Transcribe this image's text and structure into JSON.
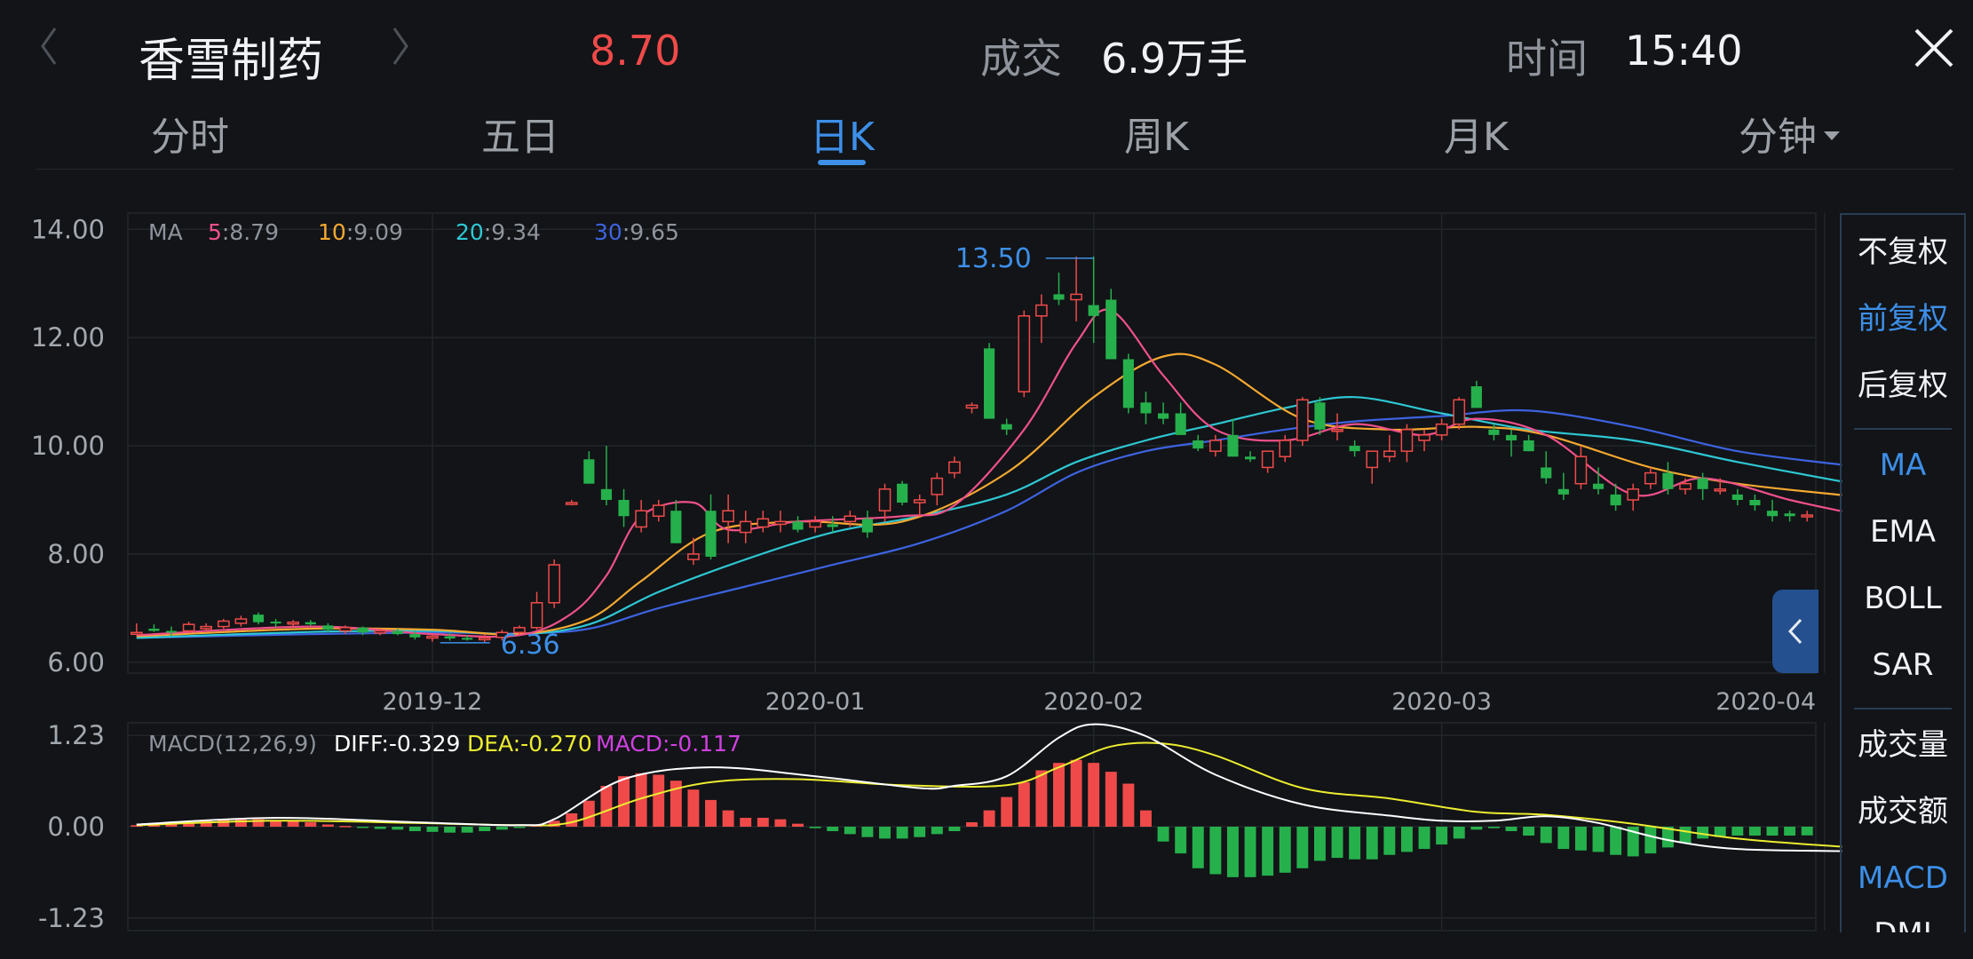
{
  "header": {
    "stock_name": "香雪制药",
    "price": "8.70",
    "volume_label": "成交",
    "volume_value": "6.9万手",
    "time_label": "时间",
    "time_value": "15:40"
  },
  "tabs": [
    {
      "label": "分时",
      "active": false
    },
    {
      "label": "五日",
      "active": false
    },
    {
      "label": "日K",
      "active": true
    },
    {
      "label": "周K",
      "active": false
    },
    {
      "label": "月K",
      "active": false
    },
    {
      "label": "分钟",
      "active": false
    }
  ],
  "side_panel": {
    "items": [
      "不复权",
      "前复权",
      "后复权",
      "MA",
      "EMA",
      "BOLL",
      "SAR",
      "成交量",
      "成交额",
      "MACD",
      "DMI"
    ],
    "highlighted": [
      "前复权",
      "MA",
      "MACD"
    ]
  },
  "colors": {
    "up": "#ef4a49",
    "down": "#26b04c",
    "ma5": "#f0508c",
    "ma10": "#f4a831",
    "ma20": "#2ec7d3",
    "ma30": "#3d63e0",
    "diff": "#ffffff",
    "dea": "#ecec30",
    "macd": "#d040e0",
    "accent": "#3d8fe8",
    "background": "#121417"
  },
  "legend": {
    "ma_prefix": "MA",
    "ma5_key": "5",
    "ma5_val": ":8.79",
    "ma10_key": "10",
    "ma10_val": ":9.09",
    "ma20_key": "20",
    "ma20_val": ":9.34",
    "ma30_key": "30",
    "ma30_val": ":9.65",
    "macd_title": "MACD(12,26,9)",
    "diff_text": "DIFF:-0.329",
    "dea_text": "DEA:-0.270",
    "macd_text": "MACD:-0.117"
  },
  "chart_data": [
    {
      "type": "candlestick",
      "y_ticks": [
        "14.00",
        "12.00",
        "10.00",
        "8.00",
        "6.00"
      ],
      "y_tick_values": [
        14,
        12,
        10,
        8,
        6
      ],
      "ylim": [
        5.8,
        14.3
      ],
      "x_ticks": [
        "2019-12",
        "2020-01",
        "2020-02",
        "2020-03",
        "2020-04"
      ],
      "x_tick_index": [
        17.5,
        39.5,
        55.5,
        75.5,
        97.5
      ],
      "max_label": "13.50",
      "min_label": "6.36",
      "max_index": 55,
      "min_index": 20,
      "candles": [
        [
          6.55,
          6.72,
          6.5,
          6.55
        ],
        [
          6.62,
          6.7,
          6.56,
          6.58
        ],
        [
          6.58,
          6.66,
          6.48,
          6.55
        ],
        [
          6.58,
          6.75,
          6.55,
          6.7
        ],
        [
          6.62,
          6.72,
          6.57,
          6.66
        ],
        [
          6.66,
          6.8,
          6.62,
          6.76
        ],
        [
          6.72,
          6.86,
          6.66,
          6.8
        ],
        [
          6.88,
          6.92,
          6.7,
          6.74
        ],
        [
          6.75,
          6.8,
          6.65,
          6.72
        ],
        [
          6.72,
          6.78,
          6.66,
          6.74
        ],
        [
          6.74,
          6.78,
          6.68,
          6.7
        ],
        [
          6.68,
          6.72,
          6.55,
          6.6
        ],
        [
          6.58,
          6.68,
          6.52,
          6.64
        ],
        [
          6.64,
          6.66,
          6.5,
          6.55
        ],
        [
          6.54,
          6.62,
          6.5,
          6.58
        ],
        [
          6.58,
          6.62,
          6.5,
          6.52
        ],
        [
          6.52,
          6.58,
          6.42,
          6.46
        ],
        [
          6.46,
          6.52,
          6.38,
          6.48
        ],
        [
          6.48,
          6.54,
          6.4,
          6.44
        ],
        [
          6.45,
          6.5,
          6.4,
          6.44
        ],
        [
          6.44,
          6.52,
          6.36,
          6.45
        ],
        [
          6.46,
          6.6,
          6.4,
          6.55
        ],
        [
          6.55,
          6.68,
          6.5,
          6.64
        ],
        [
          6.64,
          7.3,
          6.6,
          7.1
        ],
        [
          7.1,
          7.9,
          7.0,
          7.8
        ],
        [
          8.95,
          9.0,
          8.9,
          8.95
        ],
        [
          9.75,
          9.9,
          9.3,
          9.3
        ],
        [
          9.2,
          10.0,
          8.9,
          9.0
        ],
        [
          9.0,
          9.2,
          8.5,
          8.7
        ],
        [
          8.5,
          9.0,
          8.4,
          8.8
        ],
        [
          8.7,
          9.0,
          8.6,
          8.9
        ],
        [
          8.8,
          9.0,
          8.2,
          8.2
        ],
        [
          7.9,
          8.3,
          7.8,
          8.0
        ],
        [
          8.8,
          9.1,
          7.9,
          7.95
        ],
        [
          8.6,
          9.1,
          8.2,
          8.8
        ],
        [
          8.4,
          8.8,
          8.2,
          8.6
        ],
        [
          8.5,
          8.8,
          8.4,
          8.65
        ],
        [
          8.55,
          8.8,
          8.4,
          8.6
        ],
        [
          8.6,
          8.7,
          8.4,
          8.45
        ],
        [
          8.5,
          8.7,
          8.4,
          8.6
        ],
        [
          8.55,
          8.7,
          8.4,
          8.5
        ],
        [
          8.6,
          8.8,
          8.5,
          8.7
        ],
        [
          8.65,
          8.8,
          8.3,
          8.4
        ],
        [
          8.8,
          9.3,
          8.6,
          9.2
        ],
        [
          9.3,
          9.35,
          8.9,
          8.95
        ],
        [
          8.95,
          9.1,
          8.7,
          9.0
        ],
        [
          9.1,
          9.5,
          8.9,
          9.4
        ],
        [
          9.5,
          9.8,
          9.4,
          9.7
        ],
        [
          10.7,
          10.8,
          10.6,
          10.75
        ],
        [
          11.8,
          11.9,
          10.5,
          10.5
        ],
        [
          10.4,
          10.5,
          10.2,
          10.3
        ],
        [
          11.0,
          12.5,
          10.9,
          12.4
        ],
        [
          12.4,
          12.8,
          11.9,
          12.6
        ],
        [
          12.8,
          13.2,
          12.6,
          12.7
        ],
        [
          12.7,
          13.5,
          12.3,
          12.8
        ],
        [
          12.6,
          13.5,
          11.9,
          12.4
        ],
        [
          12.7,
          12.9,
          11.6,
          11.6
        ],
        [
          11.6,
          11.7,
          10.6,
          10.7
        ],
        [
          10.8,
          11.0,
          10.4,
          10.6
        ],
        [
          10.6,
          10.8,
          10.4,
          10.5
        ],
        [
          10.6,
          10.8,
          10.2,
          10.2
        ],
        [
          10.1,
          10.2,
          9.9,
          9.95
        ],
        [
          9.9,
          10.2,
          9.8,
          10.1
        ],
        [
          10.2,
          10.5,
          9.8,
          9.8
        ],
        [
          9.8,
          9.9,
          9.7,
          9.75
        ],
        [
          9.6,
          9.9,
          9.5,
          9.9
        ],
        [
          9.8,
          10.2,
          9.7,
          10.1
        ],
        [
          10.1,
          10.9,
          10.0,
          10.85
        ],
        [
          10.8,
          10.9,
          10.2,
          10.3
        ],
        [
          10.3,
          10.6,
          10.1,
          10.3
        ],
        [
          10.0,
          10.1,
          9.8,
          9.9
        ],
        [
          9.6,
          9.9,
          9.3,
          9.9
        ],
        [
          9.8,
          10.2,
          9.7,
          9.9
        ],
        [
          9.9,
          10.4,
          9.7,
          10.3
        ],
        [
          10.1,
          10.3,
          9.9,
          10.2
        ],
        [
          10.2,
          10.5,
          10.1,
          10.4
        ],
        [
          10.4,
          10.9,
          10.3,
          10.85
        ],
        [
          11.1,
          11.2,
          10.7,
          10.7
        ],
        [
          10.3,
          10.4,
          10.1,
          10.2
        ],
        [
          10.2,
          10.3,
          9.8,
          10.1
        ],
        [
          10.1,
          10.2,
          9.9,
          9.9
        ],
        [
          9.6,
          9.9,
          9.3,
          9.4
        ],
        [
          9.2,
          9.5,
          9.0,
          9.1
        ],
        [
          9.3,
          10.0,
          9.2,
          9.8
        ],
        [
          9.3,
          9.6,
          9.1,
          9.2
        ],
        [
          9.1,
          9.3,
          8.8,
          8.9
        ],
        [
          9.0,
          9.3,
          8.8,
          9.2
        ],
        [
          9.3,
          9.6,
          9.2,
          9.5
        ],
        [
          9.5,
          9.7,
          9.1,
          9.2
        ],
        [
          9.2,
          9.4,
          9.1,
          9.3
        ],
        [
          9.4,
          9.5,
          9.0,
          9.2
        ],
        [
          9.2,
          9.4,
          9.1,
          9.2
        ],
        [
          9.1,
          9.2,
          8.9,
          9.0
        ],
        [
          9.0,
          9.1,
          8.8,
          8.9
        ],
        [
          8.8,
          9.0,
          8.6,
          8.7
        ],
        [
          8.75,
          8.8,
          8.6,
          8.7
        ],
        [
          8.7,
          8.8,
          8.6,
          8.72
        ]
      ],
      "ma_series": {
        "MA5": [
          [
            0,
            6.5
          ],
          [
            10,
            6.66
          ],
          [
            17,
            6.52
          ],
          [
            22,
            6.5
          ],
          [
            25,
            6.9
          ],
          [
            27,
            7.6
          ],
          [
            29,
            8.7
          ],
          [
            32,
            8.95
          ],
          [
            34,
            8.45
          ],
          [
            38,
            8.6
          ],
          [
            44,
            8.7
          ],
          [
            47,
            8.9
          ],
          [
            51,
            10.3
          ],
          [
            54,
            11.9
          ],
          [
            56,
            12.5
          ],
          [
            59,
            11.3
          ],
          [
            62,
            10.3
          ],
          [
            66,
            10.1
          ],
          [
            70,
            10.4
          ],
          [
            74,
            10.2
          ],
          [
            77,
            10.5
          ],
          [
            81,
            10.2
          ],
          [
            86,
            9.1
          ],
          [
            90,
            9.4
          ],
          [
            95,
            9.0
          ],
          [
            98,
            8.79
          ]
        ],
        "MA10": [
          [
            0,
            6.48
          ],
          [
            10,
            6.62
          ],
          [
            17,
            6.6
          ],
          [
            22,
            6.52
          ],
          [
            26,
            6.8
          ],
          [
            29,
            7.5
          ],
          [
            33,
            8.4
          ],
          [
            38,
            8.6
          ],
          [
            44,
            8.6
          ],
          [
            50,
            9.5
          ],
          [
            55,
            10.9
          ],
          [
            59,
            11.65
          ],
          [
            62,
            11.5
          ],
          [
            67,
            10.5
          ],
          [
            72,
            10.3
          ],
          [
            77,
            10.35
          ],
          [
            81,
            10.2
          ],
          [
            87,
            9.6
          ],
          [
            92,
            9.3
          ],
          [
            98,
            9.09
          ]
        ],
        "MA20": [
          [
            0,
            6.45
          ],
          [
            10,
            6.56
          ],
          [
            17,
            6.58
          ],
          [
            22,
            6.52
          ],
          [
            26,
            6.7
          ],
          [
            30,
            7.3
          ],
          [
            35,
            7.9
          ],
          [
            40,
            8.4
          ],
          [
            45,
            8.7
          ],
          [
            50,
            9.1
          ],
          [
            54,
            9.7
          ],
          [
            58,
            10.1
          ],
          [
            62,
            10.4
          ],
          [
            66,
            10.7
          ],
          [
            70,
            10.9
          ],
          [
            75,
            10.6
          ],
          [
            80,
            10.3
          ],
          [
            86,
            10.1
          ],
          [
            92,
            9.7
          ],
          [
            98,
            9.34
          ]
        ],
        "MA30": [
          [
            0,
            6.45
          ],
          [
            10,
            6.52
          ],
          [
            17,
            6.55
          ],
          [
            22,
            6.53
          ],
          [
            26,
            6.62
          ],
          [
            30,
            7.0
          ],
          [
            35,
            7.4
          ],
          [
            40,
            7.8
          ],
          [
            45,
            8.2
          ],
          [
            50,
            8.8
          ],
          [
            54,
            9.5
          ],
          [
            58,
            9.9
          ],
          [
            62,
            10.1
          ],
          [
            66,
            10.3
          ],
          [
            70,
            10.45
          ],
          [
            75,
            10.55
          ],
          [
            80,
            10.65
          ],
          [
            86,
            10.35
          ],
          [
            92,
            9.9
          ],
          [
            98,
            9.65
          ]
        ]
      }
    },
    {
      "type": "macd",
      "y_ticks": [
        "1.23",
        "0.00",
        "-1.23"
      ],
      "y_tick_values": [
        1.23,
        0.0,
        -1.23
      ],
      "ylim": [
        -1.4,
        1.4
      ],
      "histogram": [
        0.02,
        0.03,
        0.04,
        0.06,
        0.08,
        0.09,
        0.1,
        0.1,
        0.09,
        0.08,
        0.06,
        0.03,
        0.01,
        -0.01,
        -0.03,
        -0.04,
        -0.06,
        -0.07,
        -0.08,
        -0.08,
        -0.06,
        -0.04,
        -0.01,
        0.03,
        0.08,
        0.18,
        0.35,
        0.55,
        0.68,
        0.72,
        0.7,
        0.62,
        0.5,
        0.36,
        0.22,
        0.12,
        0.12,
        0.1,
        0.04,
        -0.02,
        -0.06,
        -0.1,
        -0.14,
        -0.16,
        -0.16,
        -0.14,
        -0.1,
        -0.06,
        0.06,
        0.22,
        0.4,
        0.6,
        0.76,
        0.86,
        0.9,
        0.86,
        0.74,
        0.58,
        0.22,
        -0.2,
        -0.36,
        -0.56,
        -0.64,
        -0.68,
        -0.68,
        -0.66,
        -0.62,
        -0.56,
        -0.46,
        -0.42,
        -0.44,
        -0.44,
        -0.38,
        -0.34,
        -0.3,
        -0.24,
        -0.16,
        -0.04,
        -0.02,
        -0.06,
        -0.12,
        -0.22,
        -0.3,
        -0.32,
        -0.34,
        -0.38,
        -0.4,
        -0.36,
        -0.28,
        -0.22,
        -0.16,
        -0.14,
        -0.12,
        -0.12,
        -0.12,
        -0.12,
        -0.117
      ],
      "diff_line": [
        [
          0,
          0.03
        ],
        [
          8,
          0.12
        ],
        [
          16,
          0.06
        ],
        [
          22,
          0.02
        ],
        [
          24,
          0.1
        ],
        [
          28,
          0.64
        ],
        [
          33,
          0.8
        ],
        [
          39,
          0.68
        ],
        [
          45,
          0.52
        ],
        [
          47,
          0.55
        ],
        [
          50,
          0.68
        ],
        [
          53,
          1.2
        ],
        [
          55,
          1.38
        ],
        [
          58,
          1.22
        ],
        [
          62,
          0.7
        ],
        [
          67,
          0.3
        ],
        [
          72,
          0.15
        ],
        [
          75,
          0.08
        ],
        [
          78,
          0.08
        ],
        [
          81,
          0.14
        ],
        [
          84,
          0.05
        ],
        [
          88,
          -0.18
        ],
        [
          92,
          -0.3
        ],
        [
          98,
          -0.329
        ]
      ],
      "dea_line": [
        [
          0,
          0.02
        ],
        [
          8,
          0.08
        ],
        [
          16,
          0.05
        ],
        [
          22,
          0.02
        ],
        [
          25,
          0.06
        ],
        [
          29,
          0.38
        ],
        [
          33,
          0.6
        ],
        [
          38,
          0.64
        ],
        [
          44,
          0.56
        ],
        [
          50,
          0.56
        ],
        [
          53,
          0.8
        ],
        [
          56,
          1.08
        ],
        [
          59,
          1.12
        ],
        [
          62,
          0.96
        ],
        [
          67,
          0.52
        ],
        [
          72,
          0.38
        ],
        [
          77,
          0.2
        ],
        [
          81,
          0.16
        ],
        [
          86,
          0.04
        ],
        [
          92,
          -0.16
        ],
        [
          98,
          -0.27
        ]
      ]
    }
  ]
}
